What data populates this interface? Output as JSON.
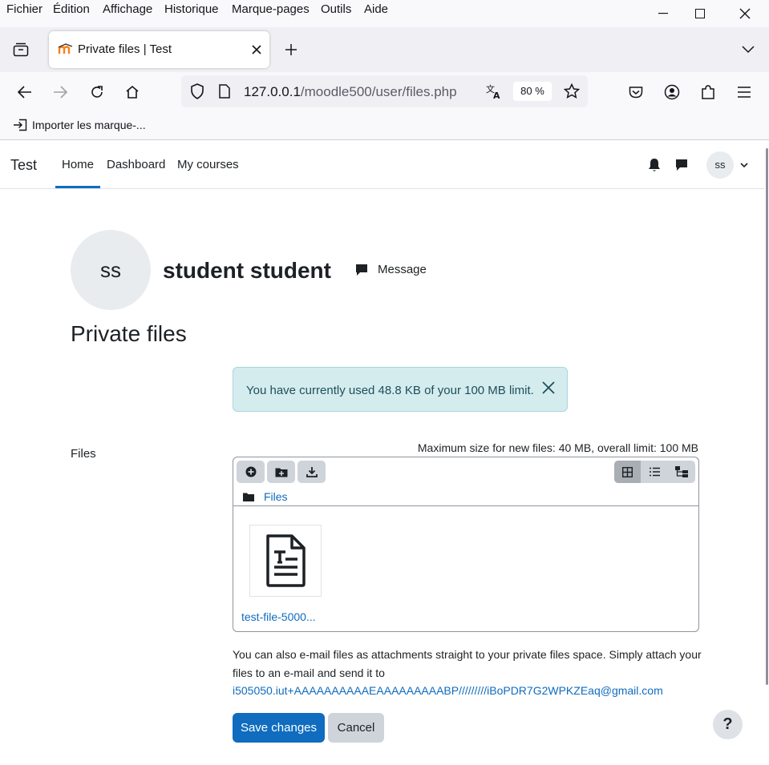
{
  "menubar": {
    "items": [
      "Fichier",
      "Édition",
      "Affichage",
      "Historique",
      "Marque-pages",
      "Outils",
      "Aide"
    ]
  },
  "browser": {
    "tab_title": "Private files | Test",
    "url_host": "127.0.0.1",
    "url_path": "/moodle500/user/files.php",
    "zoom": "80 %",
    "bookmark_item": "Importer les marque-..."
  },
  "moodle_nav": {
    "brand": "Test",
    "links": [
      "Home",
      "Dashboard",
      "My courses"
    ],
    "active_link": "Home",
    "user_initials": "ss"
  },
  "profile": {
    "initials": "ss",
    "fullname": "student student",
    "message_label": "Message"
  },
  "page": {
    "heading": "Private files",
    "alert": "You have currently used 48.8 KB of your 100 MB limit.",
    "files_label": "Files",
    "max_size": "Maximum size for new files: 40 MB, overall limit: 100 MB",
    "path_label": "Files",
    "file_name": "test-file-5000...",
    "email_text": "You can also e-mail files as attachments straight to your private files space. Simply attach your files to an e-mail and send it to",
    "email_address": "i505050.iut+AAAAAAAAAAEAAAAAAAAABP/////////iBoPDR7G2WPKZEaq@gmail.com",
    "save_label": "Save changes",
    "cancel_label": "Cancel",
    "help_label": "?"
  },
  "colors": {
    "primary": "#0f6cbf",
    "alert_bg": "#d5ecee",
    "secondary_btn": "#ced4da"
  }
}
